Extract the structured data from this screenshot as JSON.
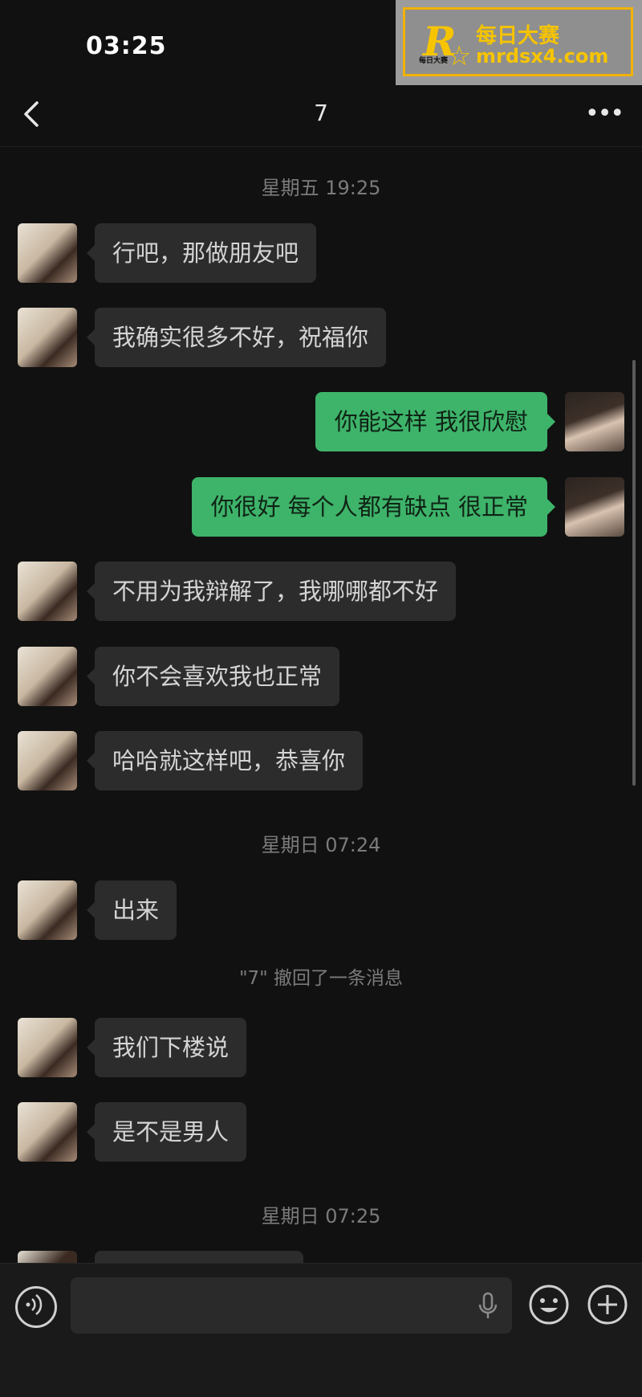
{
  "status_bar": {
    "time": "03:25"
  },
  "watermark": {
    "letter": "R",
    "line1": "每日大赛",
    "line2": "mrdsx4.com",
    "small": "每日大赛"
  },
  "nav": {
    "title": "7",
    "more_label": "•••"
  },
  "messages": [
    {
      "type": "timestamp",
      "text": "星期五 19:25"
    },
    {
      "type": "received",
      "text": "行吧，那做朋友吧"
    },
    {
      "type": "received",
      "text": "我确实很多不好，祝福你"
    },
    {
      "type": "sent",
      "text": "你能这样 我很欣慰"
    },
    {
      "type": "sent",
      "text": "你很好 每个人都有缺点 很正常"
    },
    {
      "type": "received",
      "text": "不用为我辩解了，我哪哪都不好"
    },
    {
      "type": "received",
      "text": "你不会喜欢我也正常"
    },
    {
      "type": "received",
      "text": "哈哈就这样吧，恭喜你"
    },
    {
      "type": "timestamp",
      "text": "星期日 07:24"
    },
    {
      "type": "received",
      "text": "出来"
    },
    {
      "type": "system",
      "text": "\"7\" 撤回了一条消息"
    },
    {
      "type": "received",
      "text": "我们下楼说"
    },
    {
      "type": "received",
      "text": "是不是男人"
    },
    {
      "type": "timestamp",
      "text": "星期日 07:25"
    }
  ],
  "input_bar": {
    "placeholder": ""
  },
  "colors": {
    "background": "#111111",
    "bubble_received": "#2c2c2c",
    "bubble_sent": "#3eb36a",
    "timestamp": "#7b7b7b"
  }
}
